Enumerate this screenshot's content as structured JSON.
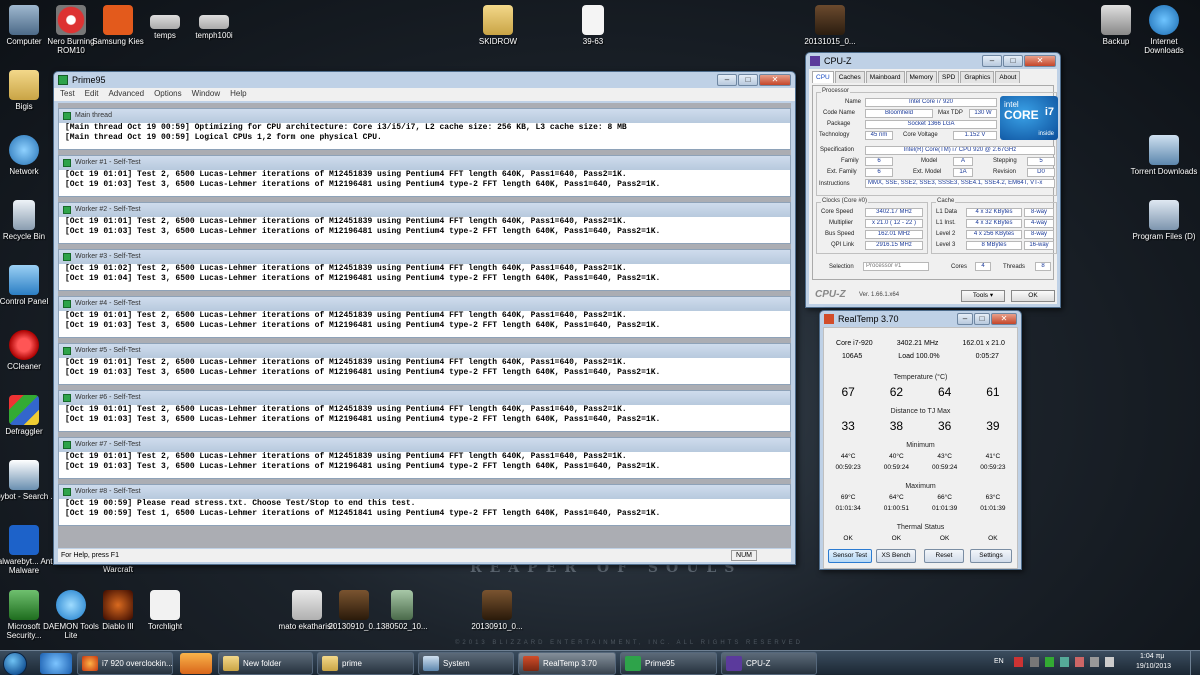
{
  "desktop": {
    "icons": [
      {
        "label": "Computer"
      },
      {
        "label": "Nero Burning ROM10"
      },
      {
        "label": "Samsung Kies"
      },
      {
        "label": "temps"
      },
      {
        "label": "temph100i"
      },
      {
        "label": "SKIDROW"
      },
      {
        "label": "39-63"
      },
      {
        "label": "20131015_0..."
      },
      {
        "label": "Backup"
      },
      {
        "label": "Internet Downloads"
      },
      {
        "label": "Bigis"
      },
      {
        "label": "Network"
      },
      {
        "label": "Torrent Downloads"
      },
      {
        "label": "Recycle Bin"
      },
      {
        "label": "Program Files (D)"
      },
      {
        "label": "Control Panel"
      },
      {
        "label": "CCleaner"
      },
      {
        "label": "Defraggler"
      },
      {
        "label": "Spybot - Search ..."
      },
      {
        "label": "Malwarebyt... Anti-Malware"
      },
      {
        "label": "Warcraft"
      },
      {
        "label": "Microsoft Security..."
      },
      {
        "label": "DAEMON Tools Lite"
      },
      {
        "label": "Diablo III"
      },
      {
        "label": "Torchlight"
      },
      {
        "label": "mato ekatharish"
      },
      {
        "label": "20130910_0..."
      },
      {
        "label": "1380502_10..."
      },
      {
        "label": "20130910_0..."
      }
    ],
    "wallpaper_text": "REAPER OF SOULS",
    "wallpaper_copyright": "©2013 BLIZZARD ENTERTAINMENT, INC. ALL RIGHTS RESERVED"
  },
  "prime95": {
    "title": "Prime95",
    "menu": [
      "Test",
      "Edit",
      "Advanced",
      "Options",
      "Window",
      "Help"
    ],
    "panes": [
      {
        "title": "Main thread",
        "lines": [
          "[Main thread Oct 19 00:59] Optimizing for CPU architecture: Core i3/i5/i7, L2 cache size: 256 KB, L3 cache size: 8 MB",
          "[Main thread Oct 19 00:59] Logical CPUs 1,2 form one physical CPU."
        ]
      },
      {
        "title": "Worker #1 - Self-Test",
        "lines": [
          "[Oct 19 01:01] Test 2, 6500 Lucas-Lehmer iterations of M12451839 using Pentium4 FFT length 640K, Pass1=640, Pass2=1K.",
          "[Oct 19 01:03] Test 3, 6500 Lucas-Lehmer iterations of M12196481 using Pentium4 type-2 FFT length 640K, Pass1=640, Pass2=1K."
        ]
      },
      {
        "title": "Worker #2 - Self-Test",
        "lines": [
          "[Oct 19 01:01] Test 2, 6500 Lucas-Lehmer iterations of M12451839 using Pentium4 FFT length 640K, Pass1=640, Pass2=1K.",
          "[Oct 19 01:03] Test 3, 6500 Lucas-Lehmer iterations of M12196481 using Pentium4 type-2 FFT length 640K, Pass1=640, Pass2=1K."
        ]
      },
      {
        "title": "Worker #3 - Self-Test",
        "lines": [
          "[Oct 19 01:02] Test 2, 6500 Lucas-Lehmer iterations of M12451839 using Pentium4 FFT length 640K, Pass1=640, Pass2=1K.",
          "[Oct 19 01:04] Test 3, 6500 Lucas-Lehmer iterations of M12196481 using Pentium4 type-2 FFT length 640K, Pass1=640, Pass2=1K."
        ]
      },
      {
        "title": "Worker #4 - Self-Test",
        "lines": [
          "[Oct 19 01:01] Test 2, 6500 Lucas-Lehmer iterations of M12451839 using Pentium4 FFT length 640K, Pass1=640, Pass2=1K.",
          "[Oct 19 01:03] Test 3, 6500 Lucas-Lehmer iterations of M12196481 using Pentium4 type-2 FFT length 640K, Pass1=640, Pass2=1K."
        ]
      },
      {
        "title": "Worker #5 - Self-Test",
        "lines": [
          "[Oct 19 01:01] Test 2, 6500 Lucas-Lehmer iterations of M12451839 using Pentium4 FFT length 640K, Pass1=640, Pass2=1K.",
          "[Oct 19 01:03] Test 3, 6500 Lucas-Lehmer iterations of M12196481 using Pentium4 type-2 FFT length 640K, Pass1=640, Pass2=1K."
        ]
      },
      {
        "title": "Worker #6 - Self-Test",
        "lines": [
          "[Oct 19 01:01] Test 2, 6500 Lucas-Lehmer iterations of M12451839 using Pentium4 FFT length 640K, Pass1=640, Pass2=1K.",
          "[Oct 19 01:03] Test 3, 6500 Lucas-Lehmer iterations of M12196481 using Pentium4 type-2 FFT length 640K, Pass1=640, Pass2=1K."
        ]
      },
      {
        "title": "Worker #7 - Self-Test",
        "lines": [
          "[Oct 19 01:01] Test 2, 6500 Lucas-Lehmer iterations of M12451839 using Pentium4 FFT length 640K, Pass1=640, Pass2=1K.",
          "[Oct 19 01:03] Test 3, 6500 Lucas-Lehmer iterations of M12196481 using Pentium4 type-2 FFT length 640K, Pass1=640, Pass2=1K."
        ]
      },
      {
        "title": "Worker #8 - Self-Test",
        "lines": [
          "[Oct 19 00:59] Please read stress.txt.  Choose Test/Stop to end this test.",
          "[Oct 19 00:59] Test 1, 6500 Lucas-Lehmer iterations of M12451841 using Pentium4 type-2 FFT length 640K, Pass1=640, Pass2=1K."
        ]
      }
    ],
    "status_text": "For Help, press F1",
    "status_num": "NUM"
  },
  "cpuz": {
    "title": "CPU-Z",
    "tabs": [
      "CPU",
      "Caches",
      "Mainboard",
      "Memory",
      "SPD",
      "Graphics",
      "About"
    ],
    "processor_group": "Processor",
    "name_label": "Name",
    "name": "Intel Core i7 920",
    "codename_label": "Code Name",
    "codename": "Bloomfield",
    "maxtdp_label": "Max TDP",
    "maxtdp": "130 W",
    "package_label": "Package",
    "package": "Socket 1366 LGA",
    "technology_label": "Technology",
    "technology": "45 nm",
    "voltage_label": "Core Voltage",
    "voltage": "1.152 V",
    "spec_label": "Specification",
    "spec": "Intel(R) Core(TM) i7 CPU         920  @ 2.67GHz",
    "family_label": "Family",
    "family": "6",
    "model_label": "Model",
    "model": "A",
    "stepping_label": "Stepping",
    "stepping": "5",
    "extfamily_label": "Ext. Family",
    "extfamily": "6",
    "extmodel_label": "Ext. Model",
    "extmodel": "1A",
    "revision_label": "Revision",
    "revision": "D0",
    "instructions_label": "Instructions",
    "instructions": "MMX, SSE, SSE2, SSE3, SSSE3, SSE4.1, SSE4.2, EM64T, VT-x",
    "clocks_group": "Clocks (Core #0)",
    "corespeed_label": "Core Speed",
    "corespeed": "3402.17 MHz",
    "multiplier_label": "Multiplier",
    "multiplier": "x 21.0 ( 12 - 22 )",
    "busspeed_label": "Bus Speed",
    "busspeed": "162.01 MHz",
    "qpi_label": "QPI Link",
    "qpi": "2916.15 MHz",
    "cache_group": "Cache",
    "l1d_label": "L1 Data",
    "l1d": "4 x 32 KBytes",
    "l1d_way": "8-way",
    "l1i_label": "L1 Inst.",
    "l1i": "4 x 32 KBytes",
    "l1i_way": "4-way",
    "l2_label": "Level 2",
    "l2": "4 x 256 KBytes",
    "l2_way": "8-way",
    "l3_label": "Level 3",
    "l3": "8 MBytes",
    "l3_way": "16-way",
    "selection_label": "Selection",
    "selection": "Processor #1",
    "cores_label": "Cores",
    "cores": "4",
    "threads_label": "Threads",
    "threads": "8",
    "brand": "CPU-Z",
    "version": "Ver. 1.66.1.x64",
    "tools_label": "Tools",
    "ok_label": "OK",
    "logo_brand": "intel",
    "logo_line": "CORE",
    "logo_badge": "i7",
    "logo_inside": "inside"
  },
  "realtemp": {
    "title": "RealTemp 3.70",
    "cpu": "Core i7-920",
    "freq": "3402.21 MHz",
    "mult": "162.01 x 21.0",
    "cpuid": "106A5",
    "load": "Load 100.0%",
    "time": "0:05:27",
    "temp_head": "Temperature (°C)",
    "temps": [
      "67",
      "62",
      "64",
      "61"
    ],
    "dist_head": "Distance to TJ Max",
    "dist": [
      "33",
      "38",
      "36",
      "39"
    ],
    "min_head": "Minimum",
    "min_temps": [
      "44°C",
      "40°C",
      "43°C",
      "41°C"
    ],
    "min_times": [
      "00:59:23",
      "00:59:24",
      "00:59:24",
      "00:59:23"
    ],
    "max_head": "Maximum",
    "max_temps": [
      "69°C",
      "64°C",
      "66°C",
      "63°C"
    ],
    "max_times": [
      "01:01:34",
      "01:00:51",
      "01:01:39",
      "01:01:39"
    ],
    "thermal_head": "Thermal Status",
    "thermal": [
      "OK",
      "OK",
      "OK",
      "OK"
    ],
    "buttons": [
      "Sensor Test",
      "XS Bench",
      "Reset",
      "Settings"
    ]
  },
  "taskbar": {
    "buttons": [
      {
        "label": "i7 920 overclockin..."
      },
      {
        "label": "New folder"
      },
      {
        "label": "prime"
      },
      {
        "label": "System"
      },
      {
        "label": "RealTemp 3.70"
      },
      {
        "label": "Prime95"
      },
      {
        "label": "CPU-Z"
      }
    ],
    "lang": "EN",
    "time": "1:04 πμ",
    "date": "19/10/2013"
  },
  "colors": {
    "accent": "#1a4cc4",
    "prime_icon": "#2ea34a",
    "title_bar": "#bfd1e6"
  }
}
